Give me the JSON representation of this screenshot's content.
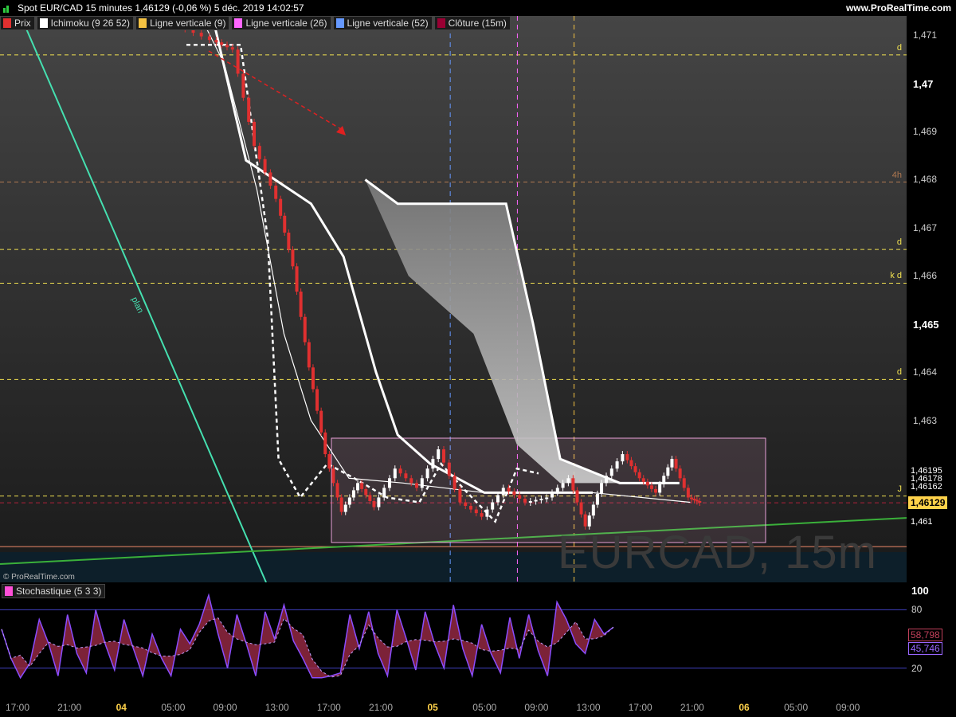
{
  "header": {
    "title": "Spot EUR/CAD 15 minutes 1,46129 (-0,06 %) 5 déc. 2019 14:02:57",
    "brand": "www.ProRealTime.com"
  },
  "legend": [
    {
      "label": "Prix",
      "color": "#e03030"
    },
    {
      "label": "Ichimoku (9 26 52)",
      "color": "#ffffff"
    },
    {
      "label": "Ligne verticale (9)",
      "color": "#f5c242"
    },
    {
      "label": "Ligne verticale (26)",
      "color": "#ff66ff"
    },
    {
      "label": "Ligne verticale (52)",
      "color": "#6699ff"
    },
    {
      "label": "Clôture (15m)",
      "color": "#990033"
    }
  ],
  "watermark": "EURCAD, 15m",
  "copyright": "© ProRealTime.com",
  "trendline_label": "plan",
  "chart_data": [
    {
      "type": "candlestick",
      "title": "Spot EUR/CAD 15 minutes",
      "ylim": [
        1.4602,
        1.4713
      ],
      "y_ticks": [
        {
          "label": "1,471",
          "value": 1.471,
          "major": false
        },
        {
          "label": "1,47",
          "value": 1.47,
          "major": true
        },
        {
          "label": "1,469",
          "value": 1.469,
          "major": false
        },
        {
          "label": "1,468",
          "value": 1.468,
          "major": false
        },
        {
          "label": "1,467",
          "value": 1.467,
          "major": false
        },
        {
          "label": "1,466",
          "value": 1.466,
          "major": false
        },
        {
          "label": "1,465",
          "value": 1.465,
          "major": true
        },
        {
          "label": "1,464",
          "value": 1.464,
          "major": false
        },
        {
          "label": "1,463",
          "value": 1.463,
          "major": false
        }
      ],
      "x_ticks": [
        {
          "label": "17:00",
          "day": false
        },
        {
          "label": "21:00",
          "day": false
        },
        {
          "label": "04",
          "day": true
        },
        {
          "label": "05:00",
          "day": false
        },
        {
          "label": "09:00",
          "day": false
        },
        {
          "label": "13:00",
          "day": false
        },
        {
          "label": "17:00",
          "day": false
        },
        {
          "label": "21:00",
          "day": false
        },
        {
          "label": "05",
          "day": true
        },
        {
          "label": "05:00",
          "day": false
        },
        {
          "label": "09:00",
          "day": false
        },
        {
          "label": "13:00",
          "day": false
        },
        {
          "label": "17:00",
          "day": false
        },
        {
          "label": "21:00",
          "day": false
        },
        {
          "label": "06",
          "day": true
        },
        {
          "label": "05:00",
          "day": false
        },
        {
          "label": "09:00",
          "day": false
        }
      ],
      "current_price": {
        "label": "1,46129",
        "value": 1.46129,
        "color": "#ffd24a"
      },
      "price_tags": [
        {
          "label": "1,46195",
          "value": 1.46195
        },
        {
          "label": "1,46178",
          "value": 1.46178
        },
        {
          "label": "1,46162",
          "value": 1.46162
        },
        {
          "label": "1,461",
          "value": 1.4609
        }
      ],
      "horizontal_levels": [
        {
          "value": 1.47059,
          "label": "d",
          "color": "#f0e050",
          "style": "dashed"
        },
        {
          "value": 1.46795,
          "label": "4h",
          "color": "#b07850",
          "style": "dashed"
        },
        {
          "value": 1.46655,
          "label": "d",
          "color": "#f0e050",
          "style": "dashed"
        },
        {
          "value": 1.46585,
          "label": "k d",
          "color": "#f0e050",
          "style": "dashed"
        },
        {
          "value": 1.46385,
          "label": "d",
          "color": "#f0e050",
          "style": "dashed"
        },
        {
          "value": 1.46143,
          "label": "J",
          "color": "#f0e050",
          "style": "dashed"
        },
        {
          "value": 1.46129,
          "label": "",
          "color": "#b0203a",
          "style": "dashed"
        },
        {
          "value": 1.46038,
          "label": "",
          "color": "#f08a6a",
          "style": "solid"
        }
      ],
      "vertical_lines": [
        {
          "time": "05 02:00",
          "color": "#6699ff"
        },
        {
          "time": "05 08:30",
          "color": "#ff66ff"
        },
        {
          "time": "05 12:00",
          "color": "#f5c242"
        }
      ],
      "price_path": [
        [
          0.4,
          1.4712
        ],
        [
          1.0,
          1.4709
        ],
        [
          1.4,
          1.4707
        ],
        [
          1.8,
          1.4687
        ],
        [
          2.2,
          1.4676
        ],
        [
          2.5,
          1.4662
        ],
        [
          2.8,
          1.4641
        ],
        [
          3.1,
          1.4623
        ],
        [
          3.4,
          1.4611
        ],
        [
          3.7,
          1.4617
        ],
        [
          4.0,
          1.4612
        ],
        [
          4.4,
          1.462
        ],
        [
          4.8,
          1.4616
        ],
        [
          5.2,
          1.4624
        ],
        [
          5.6,
          1.4613
        ],
        [
          6.0,
          1.461
        ],
        [
          6.4,
          1.4616
        ],
        [
          6.8,
          1.4613
        ],
        [
          7.2,
          1.4614
        ],
        [
          7.6,
          1.4618
        ],
        [
          7.9,
          1.4608
        ],
        [
          8.2,
          1.4617
        ],
        [
          8.6,
          1.4623
        ],
        [
          8.9,
          1.4618
        ],
        [
          9.2,
          1.4615
        ],
        [
          9.5,
          1.4622
        ],
        [
          9.8,
          1.4614
        ],
        [
          10.0,
          1.4613
        ]
      ],
      "ichimoku": {
        "tenkan": [
          [
            0.8,
            1.4713
          ],
          [
            1.2,
            1.4704
          ],
          [
            1.8,
            1.4678
          ],
          [
            2.3,
            1.4648
          ],
          [
            2.8,
            1.463
          ],
          [
            3.5,
            1.4618
          ],
          [
            4.5,
            1.4617
          ],
          [
            6.0,
            1.4615
          ],
          [
            8.0,
            1.4615
          ],
          [
            9.8,
            1.4613
          ]
        ],
        "kijun": [
          [
            1.0,
            1.4713
          ],
          [
            1.6,
            1.4684
          ],
          [
            2.8,
            1.4675
          ],
          [
            3.4,
            1.4664
          ],
          [
            4.0,
            1.464
          ],
          [
            4.4,
            1.4627
          ],
          [
            5.0,
            1.4621
          ],
          [
            6.0,
            1.4615
          ],
          [
            8.0,
            1.4615
          ]
        ],
        "senkou_a": [
          [
            3.8,
            1.468
          ],
          [
            4.6,
            1.466
          ],
          [
            5.8,
            1.4648
          ],
          [
            6.6,
            1.4625
          ],
          [
            7.4,
            1.4617
          ],
          [
            8.6,
            1.4617
          ],
          [
            9.6,
            1.4617
          ]
        ],
        "senkou_b": [
          [
            3.8,
            1.468
          ],
          [
            4.4,
            1.4675
          ],
          [
            5.8,
            1.4675
          ],
          [
            6.4,
            1.4675
          ],
          [
            6.9,
            1.465
          ],
          [
            7.4,
            1.4622
          ],
          [
            8.5,
            1.4617
          ],
          [
            9.6,
            1.4617
          ]
        ],
        "chikou": [
          [
            0.5,
            1.4708
          ],
          [
            1.5,
            1.4708
          ],
          [
            2.0,
            1.4668
          ],
          [
            2.2,
            1.4622
          ],
          [
            2.6,
            1.4614
          ],
          [
            3.1,
            1.4621
          ],
          [
            3.6,
            1.4618
          ],
          [
            4.2,
            1.4614
          ],
          [
            4.8,
            1.4613
          ],
          [
            5.2,
            1.4621
          ],
          [
            5.6,
            1.4616
          ],
          [
            6.2,
            1.4609
          ],
          [
            6.6,
            1.462
          ],
          [
            7.0,
            1.4619
          ]
        ]
      }
    },
    {
      "type": "line",
      "title": "Stochastique (5 3 3)",
      "ylim": [
        0,
        100
      ],
      "y_ticks": [
        {
          "label": "100",
          "value": 100
        },
        {
          "label": "80",
          "value": 80
        },
        {
          "label": "20",
          "value": 20
        }
      ],
      "last_values": [
        {
          "label": "58,798",
          "color": "#c0405a"
        },
        {
          "label": "45,746",
          "color": "#9966ff"
        }
      ],
      "series": [
        {
          "values": [
            60,
            30,
            10,
            25,
            70,
            45,
            12,
            75,
            35,
            15,
            80,
            45,
            18,
            70,
            40,
            12,
            55,
            30,
            12,
            60,
            45,
            65,
            95,
            55,
            20,
            75,
            45,
            12,
            78,
            50,
            85,
            48,
            30,
            10,
            10,
            12,
            15,
            75,
            40,
            78,
            35,
            12,
            80,
            50,
            18,
            78,
            45,
            20,
            85,
            40,
            12,
            65,
            35,
            15,
            72,
            30,
            75,
            38,
            12,
            88,
            70,
            45,
            35,
            70,
            55,
            62
          ]
        }
      ]
    }
  ]
}
